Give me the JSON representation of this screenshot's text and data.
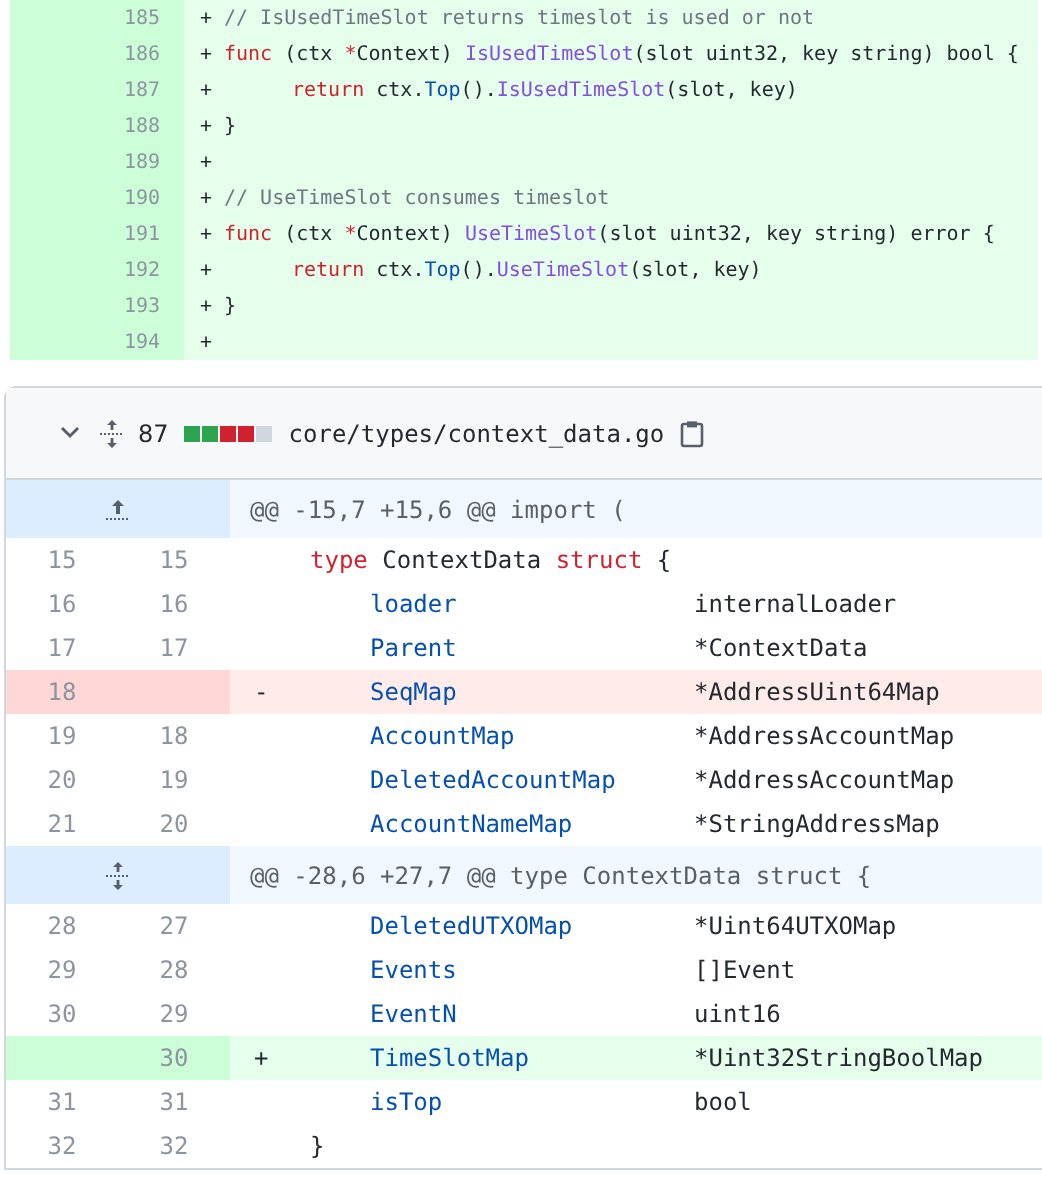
{
  "top_diff": {
    "lines": [
      {
        "number": "185",
        "sign": "+",
        "indented": false,
        "tokens": [
          {
            "text": "// IsUsedTimeSlot returns timeslot is used or not",
            "kind": "comment"
          }
        ]
      },
      {
        "number": "186",
        "sign": "+",
        "indented": false,
        "tokens": [
          {
            "text": "func",
            "kind": "keyword"
          },
          {
            "text": " (ctx ",
            "kind": "plain"
          },
          {
            "text": "*",
            "kind": "keyword"
          },
          {
            "text": "Context) ",
            "kind": "plain"
          },
          {
            "text": "IsUsedTimeSlot",
            "kind": "function"
          },
          {
            "text": "(slot uint32, key string) bool {",
            "kind": "plain"
          }
        ]
      },
      {
        "number": "187",
        "sign": "+",
        "indented": true,
        "tokens": [
          {
            "text": "return",
            "kind": "keyword"
          },
          {
            "text": " ctx.",
            "kind": "plain"
          },
          {
            "text": "Top",
            "kind": "identifier"
          },
          {
            "text": "().",
            "kind": "plain"
          },
          {
            "text": "IsUsedTimeSlot",
            "kind": "function"
          },
          {
            "text": "(slot, key)",
            "kind": "plain"
          }
        ]
      },
      {
        "number": "188",
        "sign": "+",
        "indented": false,
        "tokens": [
          {
            "text": "}",
            "kind": "plain"
          }
        ]
      },
      {
        "number": "189",
        "sign": "+"
      },
      {
        "number": "190",
        "sign": "+",
        "indented": false,
        "tokens": [
          {
            "text": "// UseTimeSlot consumes timeslot",
            "kind": "comment"
          }
        ]
      },
      {
        "number": "191",
        "sign": "+",
        "indented": false,
        "tokens": [
          {
            "text": "func",
            "kind": "keyword"
          },
          {
            "text": " (ctx ",
            "kind": "plain"
          },
          {
            "text": "*",
            "kind": "keyword"
          },
          {
            "text": "Context) ",
            "kind": "plain"
          },
          {
            "text": "UseTimeSlot",
            "kind": "function"
          },
          {
            "text": "(slot uint32, key string) error {",
            "kind": "plain"
          }
        ]
      },
      {
        "number": "192",
        "sign": "+",
        "indented": true,
        "tokens": [
          {
            "text": "return",
            "kind": "keyword"
          },
          {
            "text": " ctx.",
            "kind": "plain"
          },
          {
            "text": "Top",
            "kind": "identifier"
          },
          {
            "text": "().",
            "kind": "plain"
          },
          {
            "text": "UseTimeSlot",
            "kind": "function"
          },
          {
            "text": "(slot, key)",
            "kind": "plain"
          }
        ]
      },
      {
        "number": "193",
        "sign": "+",
        "indented": false,
        "tokens": [
          {
            "text": "}",
            "kind": "plain"
          }
        ]
      },
      {
        "number": "194",
        "sign": "+"
      }
    ]
  },
  "file_diff": {
    "expanded": true,
    "changes": "87",
    "diffstat": [
      {
        "color": "#2da44e"
      },
      {
        "color": "#2da44e"
      },
      {
        "color": "#cf222e"
      },
      {
        "color": "#cf222e"
      },
      {
        "color": "#d0d7de"
      }
    ],
    "path": "core/types/context_data.go",
    "rows": [
      {
        "kind": "hunk",
        "expand_down": false,
        "text": "@@ -15,7 +15,6 @@ import ("
      },
      {
        "kind": "code",
        "deleted": false,
        "added": false,
        "old": "15",
        "new": "15",
        "tokens": [
          {
            "text": "type",
            "kind": "keyword"
          },
          {
            "text": " ContextData ",
            "kind": "plain"
          },
          {
            "text": "struct",
            "kind": "keyword"
          },
          {
            "text": " {",
            "kind": "plain"
          }
        ]
      },
      {
        "kind": "field",
        "deleted": false,
        "added": false,
        "old": "16",
        "new": "16",
        "name": "loader",
        "value": "internalLoader"
      },
      {
        "kind": "field",
        "deleted": false,
        "added": false,
        "old": "17",
        "new": "17",
        "name": "Parent",
        "value": "*ContextData"
      },
      {
        "kind": "field",
        "deleted": true,
        "old": "18",
        "sign": "-",
        "name": "SeqMap",
        "value": "*AddressUint64Map"
      },
      {
        "kind": "field",
        "deleted": false,
        "added": false,
        "old": "19",
        "new": "18",
        "name": "AccountMap",
        "value": "*AddressAccountMap"
      },
      {
        "kind": "field",
        "deleted": false,
        "added": false,
        "old": "20",
        "new": "19",
        "name": "DeletedAccountMap",
        "value": "*AddressAccountMap"
      },
      {
        "kind": "field",
        "deleted": false,
        "added": false,
        "old": "21",
        "new": "20",
        "name": "AccountNameMap",
        "value": "*StringAddressMap"
      },
      {
        "kind": "hunk",
        "expand_down": true,
        "text": "@@ -28,6 +27,7 @@ type ContextData struct {"
      },
      {
        "kind": "field",
        "deleted": false,
        "added": false,
        "old": "28",
        "new": "27",
        "name": "DeletedUTXOMap",
        "value": "*Uint64UTXOMap"
      },
      {
        "kind": "field",
        "deleted": false,
        "added": false,
        "old": "29",
        "new": "28",
        "name": "Events",
        "value": "[]Event"
      },
      {
        "kind": "field",
        "deleted": false,
        "added": false,
        "old": "30",
        "new": "29",
        "name": "EventN",
        "value": "uint16"
      },
      {
        "kind": "field",
        "added": true,
        "new": "30",
        "sign": "+",
        "name": "TimeSlotMap",
        "value": "*Uint32StringBoolMap"
      },
      {
        "kind": "field",
        "deleted": false,
        "added": false,
        "old": "31",
        "new": "31",
        "name": "isTop",
        "value": "bool"
      },
      {
        "kind": "code",
        "deleted": false,
        "added": false,
        "old": "32",
        "new": "32",
        "tokens": [
          {
            "text": "}",
            "kind": "plain"
          }
        ]
      }
    ]
  }
}
